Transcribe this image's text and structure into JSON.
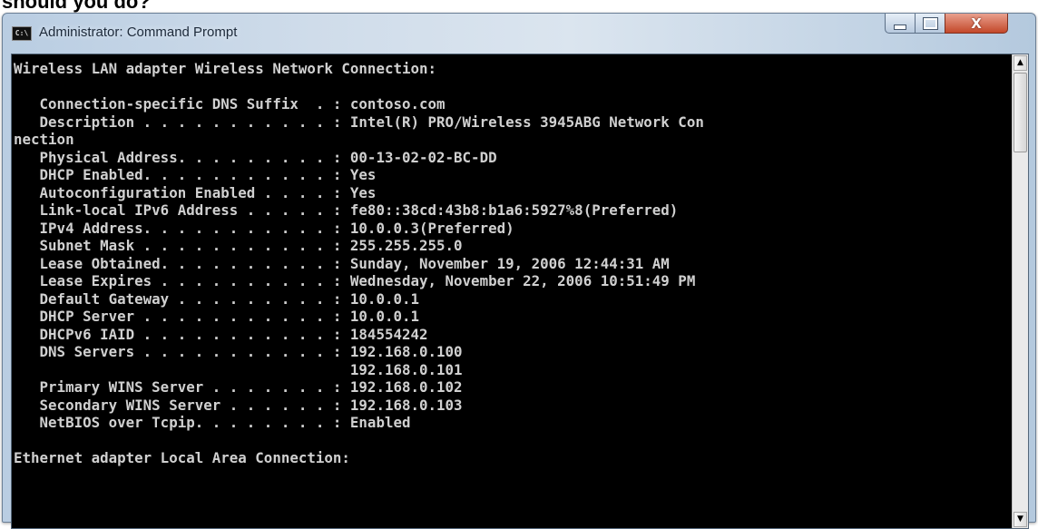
{
  "page": {
    "top_text": "should you do?"
  },
  "window": {
    "title": "Administrator: Command Prompt",
    "app_icon": "command-prompt-icon",
    "app_icon_text": "C:\\",
    "controls": {
      "minimize": "minimize-icon",
      "maximize": "maximize-icon",
      "close": "close-icon",
      "close_glyph": "X"
    }
  },
  "colors": {
    "console_background": "#000000",
    "console_text": "#d0d0d0",
    "close_button": "#c3482a",
    "title_bar": "#cfdcea"
  },
  "console": {
    "lines": [
      "Wireless LAN adapter Wireless Network Connection:",
      "",
      "   Connection-specific DNS Suffix  . : contoso.com",
      "   Description . . . . . . . . . . . : Intel(R) PRO/Wireless 3945ABG Network Con",
      "nection",
      "   Physical Address. . . . . . . . . : 00-13-02-02-BC-DD",
      "   DHCP Enabled. . . . . . . . . . . : Yes",
      "   Autoconfiguration Enabled . . . . : Yes",
      "   Link-local IPv6 Address . . . . . : fe80::38cd:43b8:b1a6:5927%8(Preferred)",
      "   IPv4 Address. . . . . . . . . . . : 10.0.0.3(Preferred)",
      "   Subnet Mask . . . . . . . . . . . : 255.255.255.0",
      "   Lease Obtained. . . . . . . . . . : Sunday, November 19, 2006 12:44:31 AM",
      "   Lease Expires . . . . . . . . . . : Wednesday, November 22, 2006 10:51:49 PM",
      "   Default Gateway . . . . . . . . . : 10.0.0.1",
      "   DHCP Server . . . . . . . . . . . : 10.0.0.1",
      "   DHCPv6 IAID . . . . . . . . . . . : 184554242",
      "   DNS Servers . . . . . . . . . . . : 192.168.0.100",
      "                                       192.168.0.101",
      "   Primary WINS Server . . . . . . . : 192.168.0.102",
      "   Secondary WINS Server . . . . . . : 192.168.0.103",
      "   NetBIOS over Tcpip. . . . . . . . : Enabled",
      "",
      "Ethernet adapter Local Area Connection:",
      "",
      ""
    ]
  },
  "scrollbar": {
    "up_icon": "scroll-up-arrow-icon",
    "down_icon": "scroll-down-arrow-icon",
    "up_glyph": "▲",
    "down_glyph": "▼"
  }
}
